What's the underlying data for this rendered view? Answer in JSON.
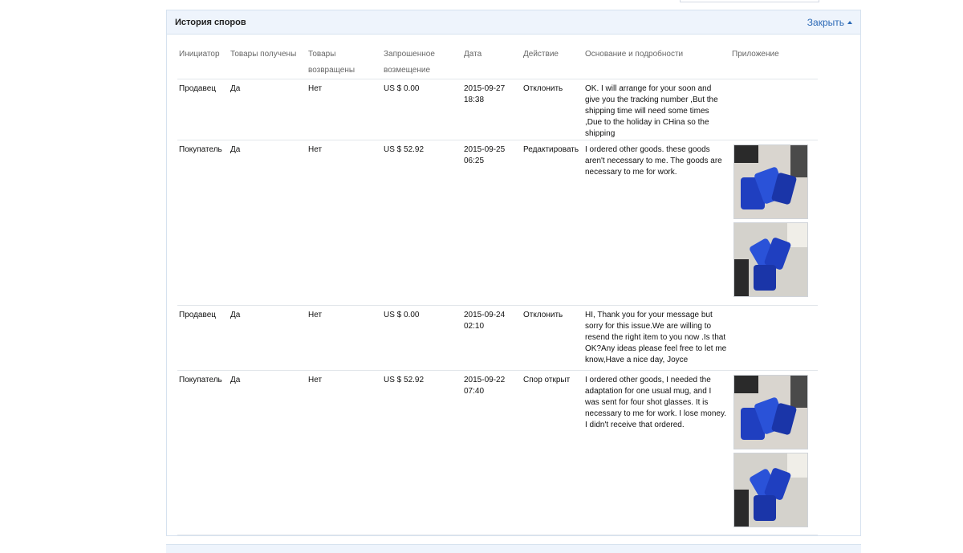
{
  "panel": {
    "title": "История споров",
    "close_label": "Закрыть"
  },
  "table": {
    "headers": {
      "initiator": "Инициатор",
      "received": "Товары получены",
      "returned": "Товары возвращены",
      "compensation": "Запрошенное возмещение",
      "date": "Дата",
      "action": "Действие",
      "reason": "Основание и подробности",
      "attachment": "Приложение"
    },
    "rows": [
      {
        "initiator": "Продавец",
        "received": "Да",
        "returned": "Нет",
        "compensation": "US $ 0.00",
        "date": "2015-09-27 18:38",
        "action": "Отклонить",
        "reason": "OK. I will arrange for your soon and give you the tracking number ,But the shipping time will need some times ,Due to the holiday in CHina so the shipping"
      },
      {
        "initiator": "Покупатель",
        "received": "Да",
        "returned": "Нет",
        "compensation": "US $ 52.92",
        "date": "2015-09-25 06:25",
        "action": "Редактировать",
        "reason": "I ordered other goods. these goods aren't necessary to me. The goods are necessary to me for work."
      },
      {
        "initiator": "Продавец",
        "received": "Да",
        "returned": "Нет",
        "compensation": "US $ 0.00",
        "date": "2015-09-24 02:10",
        "action": "Отклонить",
        "reason": "HI, Thank you for your message but sorry for this issue.We are willing to resend the right item to you now .Is that OK?Any ideas please feel free to let me know,Have a nice day, Joyce"
      },
      {
        "initiator": "Покупатель",
        "received": "Да",
        "returned": "Нет",
        "compensation": "US $ 52.92",
        "date": "2015-09-22 07:40",
        "action": "Спор открыт",
        "reason": "I ordered other goods, I needed the adaptation for one usual mug, and I was sent for four shot glasses. It is necessary to me for work. I lose money. I didn't receive that ordered."
      }
    ]
  }
}
